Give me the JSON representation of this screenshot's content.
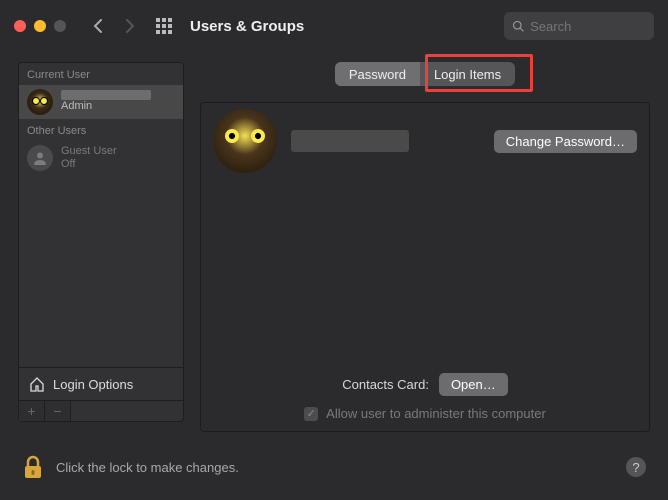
{
  "window": {
    "title": "Users & Groups",
    "search_placeholder": "Search"
  },
  "sidebar": {
    "current_label": "Current User",
    "other_label": "Other Users",
    "current_user": {
      "role": "Admin"
    },
    "guest": {
      "name": "Guest User",
      "status": "Off"
    },
    "login_options": "Login Options",
    "add": "+",
    "remove": "−"
  },
  "tabs": {
    "password": "Password",
    "login_items": "Login Items"
  },
  "main": {
    "change_password": "Change Password…",
    "contacts_label": "Contacts Card:",
    "open": "Open…",
    "admin_checkbox": "Allow user to administer this computer"
  },
  "footer": {
    "lock_text": "Click the lock to make changes.",
    "help": "?"
  }
}
